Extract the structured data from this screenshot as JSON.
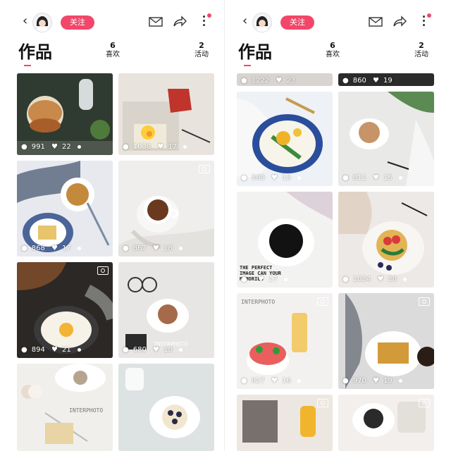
{
  "left": {
    "follow_label": "关注",
    "works_label": "作品",
    "likes_count": "6",
    "likes_label": "喜欢",
    "events_count": "2",
    "events_label": "活动",
    "tiles": [
      {
        "views": "991",
        "likes": "22"
      },
      {
        "views": "1030",
        "likes": "17"
      },
      {
        "views": "868",
        "likes": "17"
      },
      {
        "views": "867",
        "likes": "18"
      },
      {
        "views": "894",
        "likes": "21"
      },
      {
        "views": "680",
        "likes": "18"
      }
    ],
    "captions": {
      "interphoto_1": "INTERPHOTO",
      "interphoto_2": "INTERPHOTO"
    }
  },
  "right": {
    "follow_label": "关注",
    "works_label": "作品",
    "likes_count": "6",
    "likes_label": "喜欢",
    "events_count": "2",
    "events_label": "活动",
    "tiles": [
      {
        "views": "1222",
        "likes": "23"
      },
      {
        "views": "860",
        "likes": "19"
      },
      {
        "views": "589",
        "likes": "15"
      },
      {
        "views": "811",
        "likes": "15"
      },
      {
        "views": "",
        "likes": "17"
      },
      {
        "views": "1024",
        "likes": "20"
      },
      {
        "views": "927",
        "likes": "16"
      },
      {
        "views": "970",
        "likes": "19"
      }
    ],
    "captions": {
      "the_perfect": "THE PERFECT IMAGE CAN YOUR MEMORIES",
      "interphoto": "INTERPHOTO"
    }
  },
  "icons": {
    "back": "chevron-left-icon",
    "mail": "mail-icon",
    "share": "share-icon",
    "more": "more-vertical-icon"
  },
  "colors": {
    "accent": "#f2476a"
  }
}
